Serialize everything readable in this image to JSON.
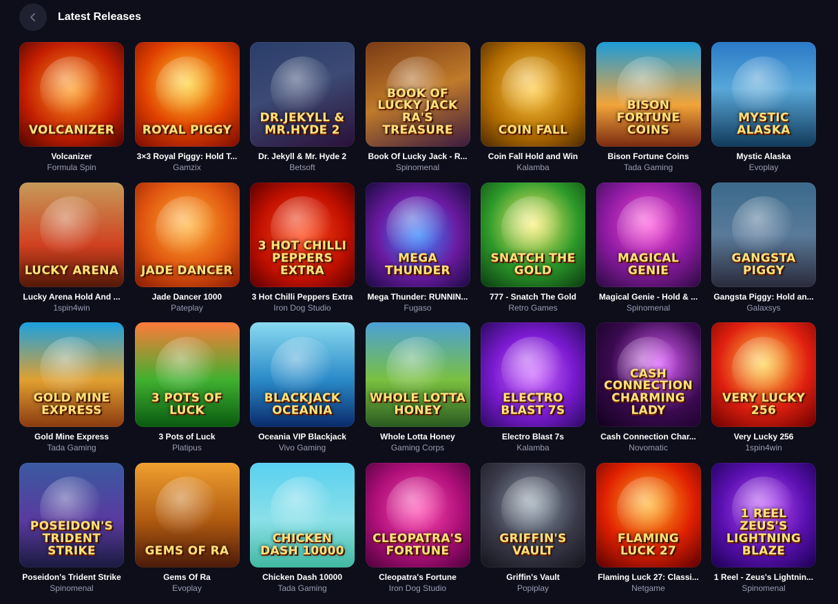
{
  "header": {
    "title": "Latest Releases",
    "back_icon": "chevron-left-icon"
  },
  "games": [
    {
      "name": "Volcanizer",
      "provider": "Formula Spin",
      "logo": "VOLCANIZER",
      "bg": "radial-gradient(circle at 50% 45%, #ff9a1f, #c41e00 60%, #4a0500)"
    },
    {
      "name": "3×3 Royal Piggy: Hold T...",
      "provider": "Gamzix",
      "logo": "ROYAL PIGGY",
      "bg": "radial-gradient(circle at 50% 40%, #ffd02a, #e04000 55%, #7a0a00)"
    },
    {
      "name": "Dr. Jekyll & Mr. Hyde 2",
      "provider": "Betsoft",
      "logo": "DR.JEKYLL & MR.HYDE 2",
      "bg": "linear-gradient(160deg, #2a3d6a, #3c4a74 45%, #2a1038)"
    },
    {
      "name": "Book Of Lucky Jack - R...",
      "provider": "Spinomenal",
      "logo": "BOOK OF LUCKY JACK RA'S TREASURE",
      "bg": "linear-gradient(160deg, #7a3a14, #c07a2a 50%, #3b1a40)"
    },
    {
      "name": "Coin Fall Hold and Win",
      "provider": "Kalamba",
      "logo": "COIN FALL",
      "bg": "radial-gradient(circle at 50% 45%, #ffc940, #b06a00 60%, #4a2800)"
    },
    {
      "name": "Bison Fortune Coins",
      "provider": "Tada Gaming",
      "logo": "BISON FORTUNE COINS",
      "bg": "linear-gradient(180deg, #1c9bd8, #f2a43a 60%, #7a2a10)"
    },
    {
      "name": "Mystic Alaska",
      "provider": "Evoplay",
      "logo": "MYSTIC ALASKA",
      "bg": "linear-gradient(180deg, #2a7ac8, #58a7d8 45%, #113a5a)"
    },
    {
      "name": "Lucky Arena Hold And ...",
      "provider": "1spin4win",
      "logo": "LUCKY ARENA",
      "bg": "linear-gradient(180deg, #c69b5a, #d04020 60%, #501808)"
    },
    {
      "name": "Jade Dancer 1000",
      "provider": "Pateplay",
      "logo": "JADE DANCER",
      "bg": "radial-gradient(circle at 50% 40%, #ffb030, #e05510 55%, #8a1a00)"
    },
    {
      "name": "3 Hot Chilli Peppers Extra",
      "provider": "Iron Dog Studio",
      "logo": "3 HOT CHILLI PEPPERS EXTRA",
      "bg": "radial-gradient(circle at 50% 50%, #ff4a1a, #c01000 60%, #5a0000)"
    },
    {
      "name": "Mega Thunder: RUNNIN...",
      "provider": "Fugaso",
      "logo": "MEGA THUNDER",
      "bg": "radial-gradient(circle at 50% 50%, #3a8aff, #6a1aa0 55%, #1a0a40)"
    },
    {
      "name": "777 - Snatch The Gold",
      "provider": "Retro Games",
      "logo": "SNATCH THE GOLD",
      "bg": "radial-gradient(circle at 50% 40%, #fff070, #2d9a2a 55%, #0a3a10)"
    },
    {
      "name": "Magical Genie - Hold & ...",
      "provider": "Spinomenal",
      "logo": "MAGICAL GENIE",
      "bg": "radial-gradient(circle at 50% 40%, #ff4ad8, #8a1aa0 55%, #2a0a40)"
    },
    {
      "name": "Gangsta Piggy: Hold an...",
      "provider": "Galaxsys",
      "logo": "GANGSTA PIGGY",
      "bg": "linear-gradient(180deg, #3a6a8a, #5a7a9a 50%, #2a2a3a)"
    },
    {
      "name": "Gold Mine Express",
      "provider": "Tada Gaming",
      "logo": "GOLD MINE EXPRESS",
      "bg": "linear-gradient(180deg, #1aa0e0, #e0a030 55%, #8a3a10)"
    },
    {
      "name": "3 Pots of Luck",
      "provider": "Platipus",
      "logo": "3 POTS OF LUCK",
      "bg": "linear-gradient(180deg, #ff7a3a, #40b030 55%, #0a5a10)"
    },
    {
      "name": "Oceania VIP Blackjack",
      "provider": "Vivo Gaming",
      "logo": "BLACKJACK OCEANIA",
      "bg": "linear-gradient(180deg, #8adaf0, #2a8ac8 55%, #0a2a6a)"
    },
    {
      "name": "Whole Lotta Honey",
      "provider": "Gaming Corps",
      "logo": "WHOLE LOTTA HONEY",
      "bg": "linear-gradient(180deg, #4aa0d8, #7ac040 55%, #2a5a20)"
    },
    {
      "name": "Electro Blast 7s",
      "provider": "Kalamba",
      "logo": "ELECTRO BLAST 7s",
      "bg": "radial-gradient(circle at 50% 50%, #d070ff, #7a1ad0 55%, #2a0a60)"
    },
    {
      "name": "Cash Connection Char...",
      "provider": "Novomatic",
      "logo": "CASH CONNECTION CHARMING LADY",
      "bg": "radial-gradient(circle at 60% 40%, #e060ff, #3a0a50 55%, #10001a)"
    },
    {
      "name": "Very Lucky 256",
      "provider": "1spin4win",
      "logo": "VERY LUCKY 256",
      "bg": "radial-gradient(circle at 50% 40%, #ffd040, #e02010 55%, #6a0000)"
    },
    {
      "name": "Poseidon's Trident Strike",
      "provider": "Spinomenal",
      "logo": "POSEIDON'S TRIDENT STRIKE",
      "bg": "linear-gradient(180deg, #3a5aa0, #5a3aa0 55%, #1a1a40)"
    },
    {
      "name": "Gems Of Ra",
      "provider": "Evoplay",
      "logo": "GEMS OF RA",
      "bg": "linear-gradient(180deg, #f0a030, #b05a10 55%, #4a1a0a)"
    },
    {
      "name": "Chicken Dash 10000",
      "provider": "Tada Gaming",
      "logo": "CHICKEN DASH 10000",
      "bg": "linear-gradient(180deg, #5ad0f0, #8ae0e8 55%, #40b8a0)"
    },
    {
      "name": "Cleopatra's Fortune",
      "provider": "Iron Dog Studio",
      "logo": "CLEOPATRA'S FORTUNE",
      "bg": "radial-gradient(circle at 50% 45%, #ff4ab0, #b0107a 55%, #4a003a)"
    },
    {
      "name": "Griffin's Vault",
      "provider": "Popiplay",
      "logo": "GRIFFIN'S VAULT",
      "bg": "radial-gradient(circle at 50% 40%, #8a9aa8, #3a3a4a 55%, #14141c)"
    },
    {
      "name": "Flaming Luck 27: Classi...",
      "provider": "Netgame",
      "logo": "FLAMING LUCK 27",
      "bg": "radial-gradient(circle at 50% 40%, #ffb020, #e02000 55%, #5a0000)"
    },
    {
      "name": "1 Reel - Zeus's Lightnin...",
      "provider": "Spinomenal",
      "logo": "1 REEL ZEUS'S LIGHTNING BLAZE",
      "bg": "radial-gradient(circle at 50% 45%, #c050ff, #5a10b0 55%, #1a0050)"
    }
  ]
}
